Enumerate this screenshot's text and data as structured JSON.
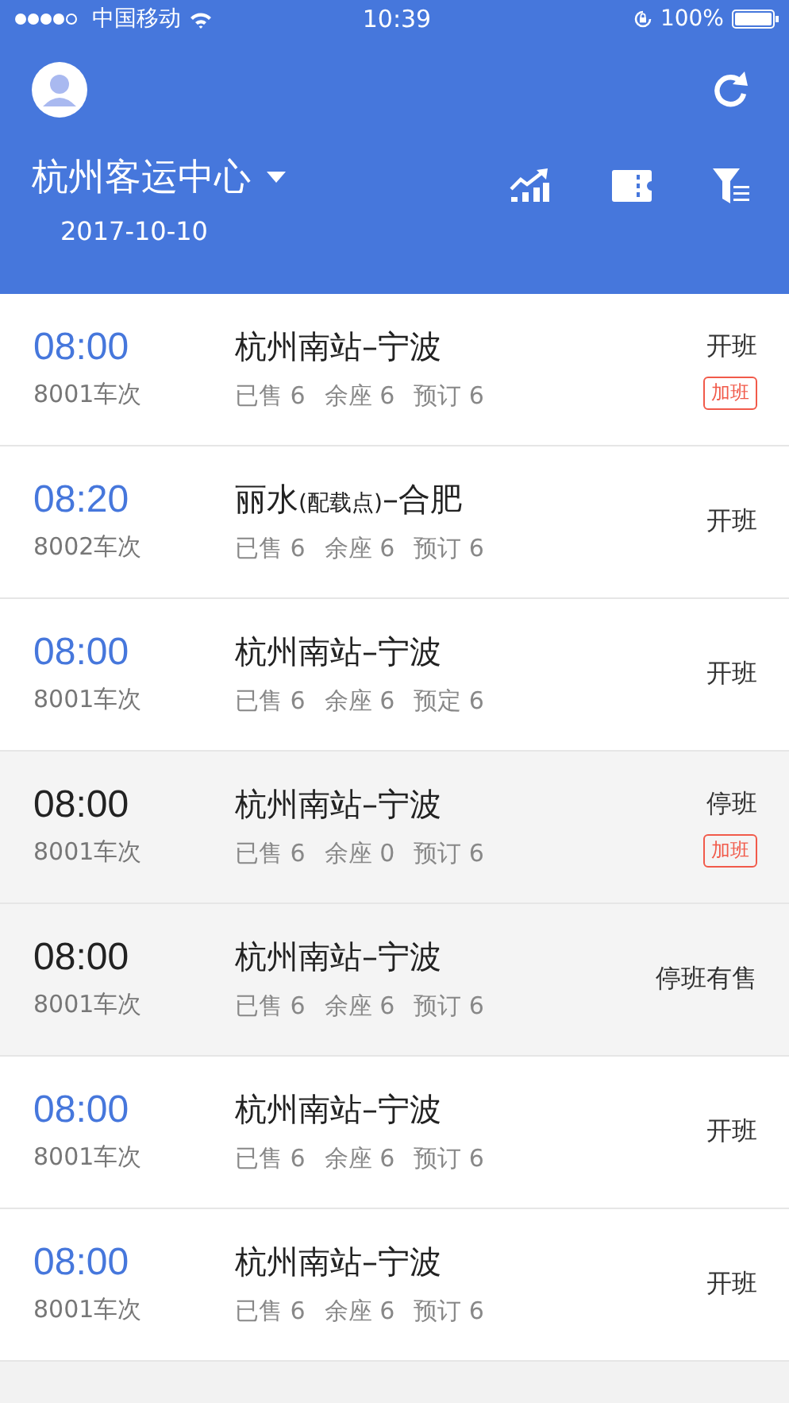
{
  "status_bar": {
    "carrier": "中国移动",
    "time": "10:39",
    "battery": "100%"
  },
  "header": {
    "station": "杭州客运中心",
    "date": "2017-10-10"
  },
  "trips": [
    {
      "time": "08:00",
      "train": "8001车次",
      "route": [
        {
          "kind": "main",
          "text": "杭州南站–宁波"
        }
      ],
      "stats": [
        "已售 6",
        "余座 6",
        "预订 6"
      ],
      "status": "开班",
      "tag": "加班",
      "stopped": false
    },
    {
      "time": "08:20",
      "train": "8002车次",
      "route": [
        {
          "kind": "main",
          "text": "丽水"
        },
        {
          "kind": "note",
          "text": "(配载点)"
        },
        {
          "kind": "main",
          "text": "–合肥"
        }
      ],
      "stats": [
        "已售 6",
        "余座 6",
        "预订 6"
      ],
      "status": "开班",
      "stopped": false
    },
    {
      "time": "08:00",
      "train": "8001车次",
      "route": [
        {
          "kind": "main",
          "text": "杭州南站–宁波"
        }
      ],
      "stats": [
        "已售 6",
        "余座 6",
        "预定 6"
      ],
      "status": "开班",
      "stopped": false
    },
    {
      "time": "08:00",
      "train": "8001车次",
      "route": [
        {
          "kind": "main",
          "text": "杭州南站–宁波"
        }
      ],
      "stats": [
        "已售 6",
        "余座 0",
        "预订 6"
      ],
      "status": "停班",
      "tag": "加班",
      "stopped": true
    },
    {
      "time": "08:00",
      "train": "8001车次",
      "route": [
        {
          "kind": "main",
          "text": "杭州南站–宁波"
        }
      ],
      "stats": [
        "已售 6",
        "余座 6",
        "预订 6"
      ],
      "status": "停班有售",
      "stopped": true
    },
    {
      "time": "08:00",
      "train": "8001车次",
      "route": [
        {
          "kind": "main",
          "text": "杭州南站–宁波"
        }
      ],
      "stats": [
        "已售 6",
        "余座 6",
        "预订 6"
      ],
      "status": "开班",
      "stopped": false
    },
    {
      "time": "08:00",
      "train": "8001车次",
      "route": [
        {
          "kind": "main",
          "text": "杭州南站–宁波"
        }
      ],
      "stats": [
        "已售 6",
        "余座 6",
        "预订 6"
      ],
      "status": "开班",
      "stopped": false
    }
  ]
}
